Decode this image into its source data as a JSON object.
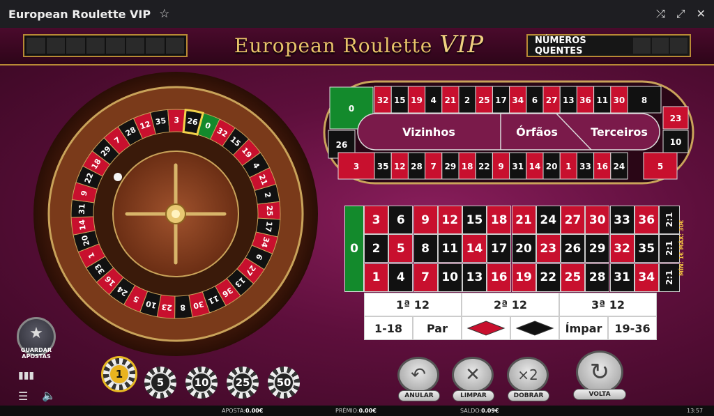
{
  "window": {
    "title": "European Roulette VIP"
  },
  "header": {
    "logo_main": "European Roulette",
    "logo_vip": "VIP",
    "hot_numbers_label": "NÚMEROS QUENTES"
  },
  "wheel": {
    "numbers": [
      0,
      32,
      15,
      19,
      4,
      21,
      2,
      25,
      17,
      34,
      6,
      27,
      13,
      36,
      11,
      30,
      8,
      23,
      10,
      5,
      24,
      16,
      33,
      1,
      20,
      14,
      31,
      9,
      22,
      18,
      29,
      7,
      28,
      12,
      35,
      3,
      26
    ],
    "highlighted_number": 26
  },
  "racetrack": {
    "top_row": [
      "32",
      "15",
      "19",
      "4",
      "21",
      "2",
      "25",
      "17",
      "34",
      "6",
      "27",
      "13",
      "36",
      "11",
      "30"
    ],
    "bottom_row": [
      "35",
      "12",
      "28",
      "7",
      "29",
      "18",
      "22",
      "9",
      "31",
      "14",
      "20",
      "1",
      "33",
      "16",
      "24"
    ],
    "right_end": [
      "8",
      "23",
      "10",
      "5"
    ],
    "left_end": [
      "0",
      "26",
      "3"
    ],
    "sections": {
      "vizinhos": "Vizinhos",
      "orfaos": "Órfãos",
      "terceiros": "Terceiros"
    }
  },
  "grid": {
    "zero": "0",
    "rows": [
      [
        "3",
        "6",
        "9",
        "12",
        "15",
        "18",
        "21",
        "24",
        "27",
        "30",
        "33",
        "36"
      ],
      [
        "2",
        "5",
        "8",
        "11",
        "14",
        "17",
        "20",
        "23",
        "26",
        "29",
        "32",
        "35"
      ],
      [
        "1",
        "4",
        "7",
        "10",
        "13",
        "16",
        "19",
        "22",
        "25",
        "28",
        "31",
        "34"
      ]
    ],
    "column_bet": "2:1",
    "limits": "MÍN: 1€   MÁX: 30€",
    "dozens": [
      "1ª 12",
      "2ª 12",
      "3ª 12"
    ],
    "low": "1-18",
    "even": "Par",
    "odd": "Ímpar",
    "high": "19-36"
  },
  "chips": [
    "1",
    "5",
    "10",
    "25",
    "50"
  ],
  "selected_chip": "1",
  "buttons": {
    "save_bets": "GUARDAR APOSTAS",
    "undo": "ANULAR",
    "clear": "LIMPAR",
    "double": "DOBRAR",
    "double_icon": "×2",
    "spin": "VOLTA"
  },
  "status": {
    "bet_label": "APOSTA:",
    "bet_value": "0.00€",
    "win_label": "PRÉMIO:",
    "win_value": "0.00€",
    "balance_label": "SALDO:",
    "balance_value": "0.09€",
    "clock": "13:57"
  },
  "colors": {
    "red": "#c8102e",
    "black": "#111111",
    "green": "#138a2c",
    "gold": "#b88a35",
    "felt": "#6e1446"
  }
}
